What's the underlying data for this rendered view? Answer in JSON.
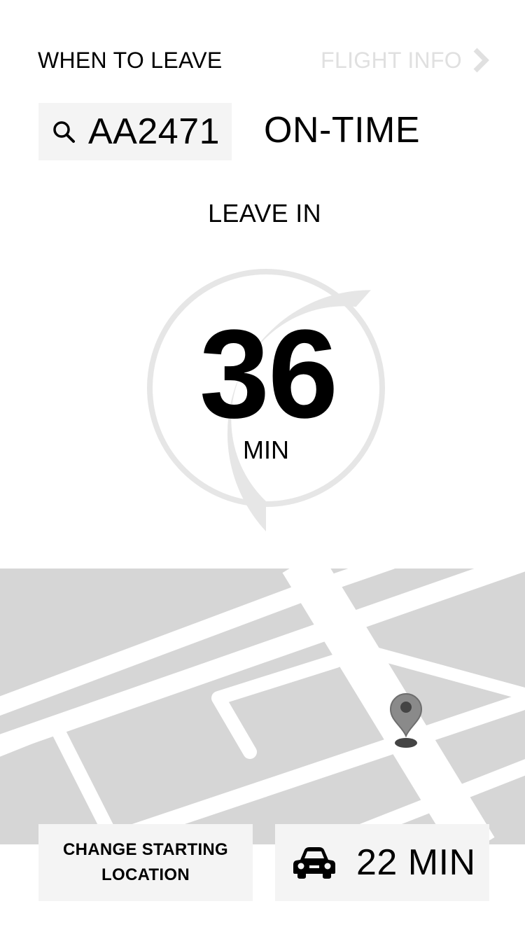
{
  "header": {
    "title": "WHEN TO LEAVE",
    "flight_info_label": "FLIGHT INFO",
    "flight_info_icon": "chevron-right-icon"
  },
  "flight": {
    "search_icon": "search-icon",
    "number": "AA2471",
    "status": "ON-TIME"
  },
  "countdown": {
    "label": "LEAVE IN",
    "value": "36",
    "unit": "MIN"
  },
  "map": {
    "pin_icon": "map-pin-icon"
  },
  "footer": {
    "change_location_label": "CHANGE STARTING LOCATION",
    "travel_icon": "car-icon",
    "travel_time": "22 MIN"
  },
  "colors": {
    "background": "#ffffff",
    "panel": "#f4f4f4",
    "muted_text": "#e0e0e0",
    "ring": "#e6e6e6",
    "map_block": "#d6d6d6",
    "pin": "#8a8a8a"
  }
}
